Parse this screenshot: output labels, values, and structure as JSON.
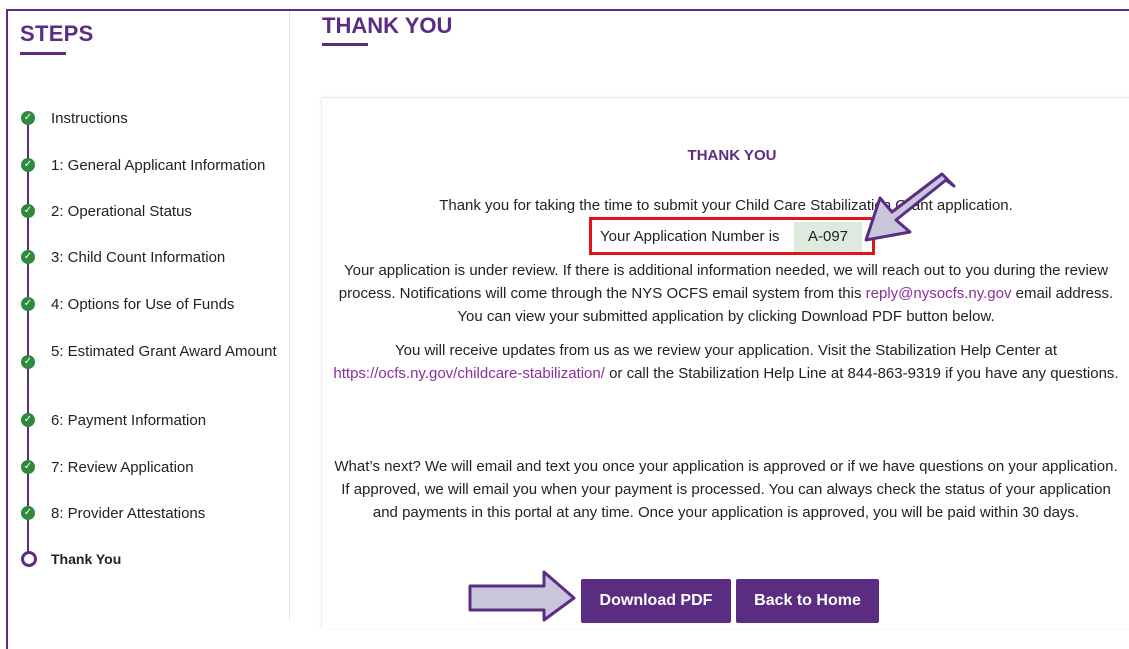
{
  "sidebar": {
    "title": "STEPS",
    "steps": [
      {
        "label": "Instructions",
        "status": "complete"
      },
      {
        "label": "1: General Applicant Information",
        "status": "complete"
      },
      {
        "label": "2: Operational Status",
        "status": "complete"
      },
      {
        "label": "3: Child Count Information",
        "status": "complete"
      },
      {
        "label": "4: Options for Use of Funds",
        "status": "complete"
      },
      {
        "label": "5: Estimated Grant Award Amount",
        "status": "complete"
      },
      {
        "label": "6: Payment Information",
        "status": "complete"
      },
      {
        "label": "7: Review Application",
        "status": "complete"
      },
      {
        "label": "8: Provider Attestations",
        "status": "complete"
      },
      {
        "label": "Thank You",
        "status": "current"
      }
    ]
  },
  "main": {
    "page_title": "THANK YOU",
    "card": {
      "heading": "THANK YOU",
      "intro": "Thank you for taking the time to submit your Child Care Stabilization Grant application.",
      "app_number_label": "Your Application Number is",
      "app_number_value": "A-097",
      "review_text_1": "Your application is under review. If there is additional information needed, we will reach out to you during the review process. Notifications will come through the NYS OCFS email system from this ",
      "review_email": "reply@nysocfs.ny.gov",
      "review_text_2": " email address. You can view your submitted application by clicking Download PDF button below.",
      "updates_text_1": "You will receive updates from us as we review your application. Visit the Stabilization Help Center at ",
      "help_center_url": "https://ocfs.ny.gov/childcare-stabilization/",
      "updates_text_2": " or call the Stabilization Help Line at 844-863-9319 if you have any questions.",
      "next_text": "What’s next? We will email and text you once your application is approved or if we have questions on your application. If approved, we will email you when your payment is processed. You can always check the status of your application and payments in this portal at any time. Once your application is approved, you will be paid within 30 days."
    },
    "buttons": {
      "download_pdf": "Download PDF",
      "back_to_home": "Back to Home"
    }
  },
  "colors": {
    "brand_purple": "#5b2d82",
    "complete_green": "#2e8a3f",
    "highlight_red": "#e3121b",
    "link_purple": "#8a2f9e",
    "arrow_fill": "#c9c6dc"
  }
}
